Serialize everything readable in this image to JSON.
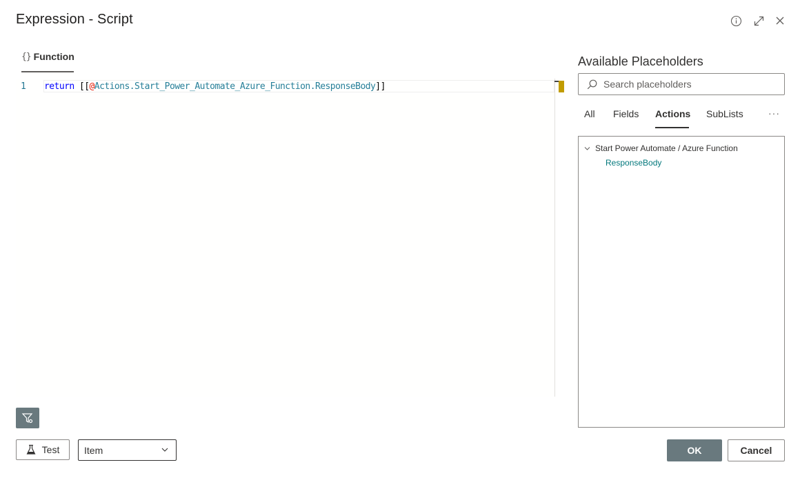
{
  "dialog": {
    "title": "Expression - Script",
    "header_icons": [
      "info-icon",
      "expand-icon",
      "close-icon"
    ]
  },
  "editor": {
    "tab_braces": "{}",
    "tab_label": "Function",
    "line_number": "1",
    "code": {
      "keyword": "return",
      "open": " [[",
      "at": "@",
      "path": "Actions.Start_Power_Automate_Azure_Function.ResponseBody",
      "close": "]]"
    }
  },
  "placeholders": {
    "title": "Available Placeholders",
    "search_placeholder": "Search placeholders",
    "tabs": [
      "All",
      "Fields",
      "Actions",
      "SubLists"
    ],
    "active_tab": "Actions",
    "more_label": "···",
    "tree": {
      "node_label": "Start Power Automate / Azure Function",
      "leaf_label": "ResponseBody"
    }
  },
  "footer": {
    "test_label": "Test",
    "item_select_value": "Item",
    "ok_label": "OK",
    "cancel_label": "Cancel"
  },
  "colors": {
    "accent_grey": "#69797e",
    "teal_link": "#03787c",
    "warning_gold": "#c19c00"
  }
}
